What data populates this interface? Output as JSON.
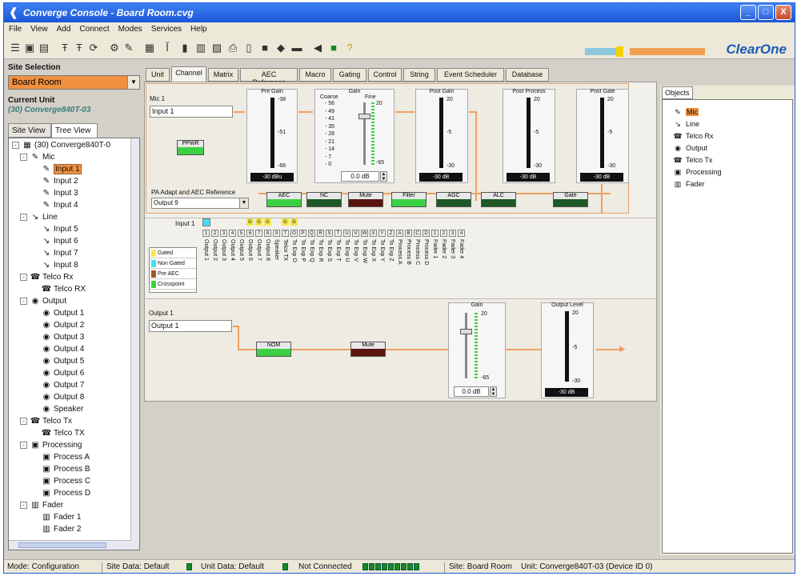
{
  "window": {
    "title": "Converge Console - Board Room.cvg",
    "controls": [
      "_",
      "□",
      "X"
    ]
  },
  "menu": [
    "File",
    "View",
    "Add",
    "Connect",
    "Modes",
    "Services",
    "Help"
  ],
  "brand": "ClearOne",
  "site": {
    "label": "Site Selection",
    "selected": "Board Room",
    "current_unit_label": "Current Unit",
    "current_unit": "(30) Converge840T-03"
  },
  "views": [
    "Site View",
    "Tree View"
  ],
  "tree": {
    "root": "(30) Converge840T-0",
    "groups": [
      {
        "label": "Mic",
        "icon": "mic-icon",
        "items": [
          "Input 1",
          "Input 2",
          "Input 3",
          "Input 4"
        ]
      },
      {
        "label": "Line",
        "icon": "line-icon",
        "items": [
          "Input 5",
          "Input 6",
          "Input 7",
          "Input 8"
        ]
      },
      {
        "label": "Telco Rx",
        "icon": "telco-rx-icon",
        "items": [
          "Telco RX"
        ]
      },
      {
        "label": "Output",
        "icon": "output-icon",
        "items": [
          "Output 1",
          "Output 2",
          "Output 3",
          "Output 4",
          "Output 5",
          "Output 6",
          "Output 7",
          "Output 8",
          "Speaker"
        ]
      },
      {
        "label": "Telco Tx",
        "icon": "telco-tx-icon",
        "items": [
          "Telco TX"
        ]
      },
      {
        "label": "Processing",
        "icon": "processing-icon",
        "items": [
          "Process A",
          "Process B",
          "Process C",
          "Process D"
        ]
      },
      {
        "label": "Fader",
        "icon": "fader-icon",
        "items": [
          "Fader 1",
          "Fader 2"
        ]
      }
    ],
    "selected": "Input 1"
  },
  "tabs": [
    "Unit",
    "Channel",
    "Matrix",
    "AEC Reference",
    "Macro",
    "Gating",
    "Control",
    "String",
    "Event Scheduler",
    "Database"
  ],
  "active_tab": "Channel",
  "channel": {
    "mic_label": "Mic 1",
    "mic_name": "Input 1",
    "phantom": "PPWR",
    "aec_ref_label": "PA Adapt and AEC Reference",
    "aec_ref_value": "Output 9",
    "pre_gain": {
      "title": "Pre Gain",
      "ticks": [
        "-38",
        "-51",
        "-66"
      ],
      "value": "-30 dBu"
    },
    "gain": {
      "title": "Gain",
      "coarse_label": "Coarse",
      "fine_label": "Fine",
      "coarse_ticks": [
        "56",
        "49",
        "41",
        "35",
        "28",
        "21",
        "14",
        "7",
        "0"
      ],
      "fine_ticks": [
        "20",
        "-65"
      ],
      "value": "0.0 dB"
    },
    "post_gain": {
      "title": "Post Gain",
      "ticks": [
        "20",
        "-5",
        "-30"
      ],
      "value": "-30 dB"
    },
    "post_process": {
      "title": "Post Process",
      "ticks": [
        "20",
        "-5",
        "-30"
      ],
      "value": "-30 dB"
    },
    "post_gate": {
      "title": "Post Gate",
      "ticks": [
        "20",
        "-5",
        "-30"
      ],
      "value": "-30 dB"
    },
    "buttons": [
      {
        "name": "AEC",
        "light": "green"
      },
      {
        "name": "NC",
        "light": "dark-green"
      },
      {
        "name": "Mute",
        "light": "maroon"
      },
      {
        "name": "Filter",
        "light": "green"
      },
      {
        "name": "AGC",
        "light": "dark-green"
      },
      {
        "name": "ALC",
        "light": "dark-green"
      },
      {
        "name": "Gate",
        "light": "dark-green"
      }
    ]
  },
  "matrix": {
    "row_label": "Input 1",
    "gate_markers": [
      "G",
      "G",
      "G",
      "G",
      "G"
    ],
    "columns": [
      "1",
      "2",
      "3",
      "4",
      "5",
      "6",
      "7",
      "8",
      "9",
      "T",
      "O",
      "P",
      "Q",
      "R",
      "S",
      "T",
      "U",
      "V",
      "W",
      "X",
      "Y",
      "Z",
      "A",
      "B",
      "C",
      "D",
      "1",
      "2",
      "3",
      "4"
    ],
    "column_labels": [
      "Output 1",
      "Output 2",
      "Output 3",
      "Output 4",
      "Output 5",
      "Output 6",
      "Output 7",
      "Output 8",
      "Speaker",
      "Telco TX",
      "To Exp O",
      "To Exp P",
      "To Exp Q",
      "To Exp R",
      "To Exp S",
      "To Exp T",
      "To Exp U",
      "To Exp V",
      "To Exp W",
      "To Exp X",
      "To Exp Y",
      "To Exp Z",
      "Process A",
      "Process B",
      "Process C",
      "Process D",
      "Fader 1",
      "Fader 2",
      "Fader 3",
      "Fader 4"
    ],
    "legend": [
      {
        "label": "Gated",
        "color": "#f5e850"
      },
      {
        "label": "Non Gated",
        "color": "#3fe0f0"
      },
      {
        "label": "Pre AEC",
        "color": "#a05a2c"
      },
      {
        "label": "Crosspoint",
        "color": "#3ad144"
      }
    ]
  },
  "output": {
    "label": "Output 1",
    "name": "Output 1",
    "nom": "NOM",
    "mute": "Mute",
    "gain": {
      "title": "Gain",
      "ticks": [
        "20",
        "-65"
      ],
      "value": "0.0 dB"
    },
    "level": {
      "title": "Output Level",
      "ticks": [
        "20",
        "-5",
        "-30"
      ],
      "value": "-30 dB"
    }
  },
  "objects": {
    "tab": "Objects",
    "items": [
      {
        "label": "Mic",
        "icon": "mic-icon"
      },
      {
        "label": "Line",
        "icon": "line-icon"
      },
      {
        "label": "Telco Rx",
        "icon": "telco-rx-icon"
      },
      {
        "label": "Output",
        "icon": "output-icon"
      },
      {
        "label": "Telco Tx",
        "icon": "telco-tx-icon"
      },
      {
        "label": "Processing",
        "icon": "processing-icon"
      },
      {
        "label": "Fader",
        "icon": "fader-icon"
      }
    ],
    "selected": "Mic"
  },
  "status": {
    "mode": "Mode: Configuration",
    "site_data": "Site Data: Default",
    "unit_data": "Unit Data: Default",
    "connection": "Not Connected",
    "site": "Site: Board Room",
    "unit": "Unit: Converge840T-03 (Device ID 0)"
  },
  "colors": {
    "accent": "#f09040",
    "title_blue": "#1b55d6",
    "led_green": "#3ad144",
    "mute_red": "#5a1410",
    "brand_blue": "#1b5bb8"
  }
}
